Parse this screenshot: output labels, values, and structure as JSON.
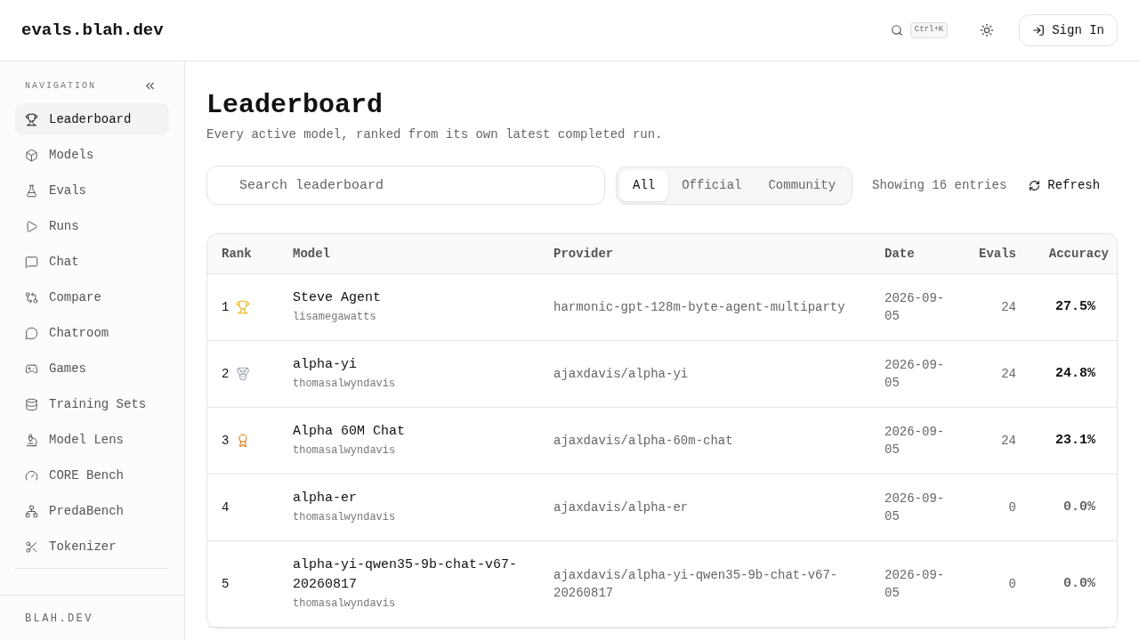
{
  "header": {
    "brand": "evals.blah.dev",
    "search_shortcut": "Ctrl+K",
    "sign_in": "Sign In"
  },
  "sidebar": {
    "heading": "NAVIGATION",
    "items": [
      {
        "label": "Leaderboard",
        "selected": true
      },
      {
        "label": "Models",
        "selected": false
      },
      {
        "label": "Evals",
        "selected": false
      },
      {
        "label": "Runs",
        "selected": false
      },
      {
        "label": "Chat",
        "selected": false
      },
      {
        "label": "Compare",
        "selected": false
      },
      {
        "label": "Chatroom",
        "selected": false
      },
      {
        "label": "Games",
        "selected": false
      },
      {
        "label": "Training Sets",
        "selected": false
      },
      {
        "label": "Model Lens",
        "selected": false
      },
      {
        "label": "CORE Bench",
        "selected": false
      },
      {
        "label": "PredaBench",
        "selected": false
      },
      {
        "label": "Tokenizer",
        "selected": false
      }
    ],
    "footer": "BLAH.DEV"
  },
  "page": {
    "title": "Leaderboard",
    "subtitle": "Every active model, ranked from its own latest completed run.",
    "search": {
      "placeholder": "Search leaderboard"
    },
    "filters": [
      {
        "label": "All",
        "selected": true
      },
      {
        "label": "Official",
        "selected": false
      },
      {
        "label": "Community",
        "selected": false
      }
    ],
    "count": "Showing 16 entries",
    "refresh": "Refresh"
  },
  "table": {
    "columns": [
      "Rank",
      "Model",
      "Provider",
      "Date",
      "Evals",
      "Accuracy"
    ],
    "rows": [
      {
        "rank": "1",
        "kind": "gold",
        "model": "Steve Agent",
        "owner": "lisamegawatts",
        "provider": "harmonic-gpt-128m-byte-agent-multiparty",
        "date": "2026-09-05",
        "evals": "24",
        "accuracy": "27.5%",
        "dimmed": false
      },
      {
        "rank": "2",
        "kind": "silver",
        "model": "alpha-yi",
        "owner": "thomasalwyndavis",
        "provider": "ajaxdavis/alpha-yi",
        "date": "2026-09-05",
        "evals": "24",
        "accuracy": "24.8%",
        "dimmed": false
      },
      {
        "rank": "3",
        "kind": "bronze",
        "model": "Alpha 60M Chat",
        "owner": "thomasalwyndavis",
        "provider": "ajaxdavis/alpha-60m-chat",
        "date": "2026-09-05",
        "evals": "24",
        "accuracy": "23.1%",
        "dimmed": false
      },
      {
        "rank": "4",
        "kind": "plain",
        "model": "alpha-er",
        "owner": "thomasalwyndavis",
        "provider": "ajaxdavis/alpha-er",
        "date": "2026-09-05",
        "evals": "0",
        "accuracy": "0.0%",
        "dimmed": true
      },
      {
        "rank": "5",
        "kind": "plain",
        "model": "alpha-yi-qwen35-9b-chat-v67-20260817",
        "owner": "thomasalwyndavis",
        "provider": "ajaxdavis/alpha-yi-qwen35-9b-chat-v67-20260817",
        "date": "2026-09-05",
        "evals": "0",
        "accuracy": "0.0%",
        "dimmed": true
      }
    ]
  }
}
